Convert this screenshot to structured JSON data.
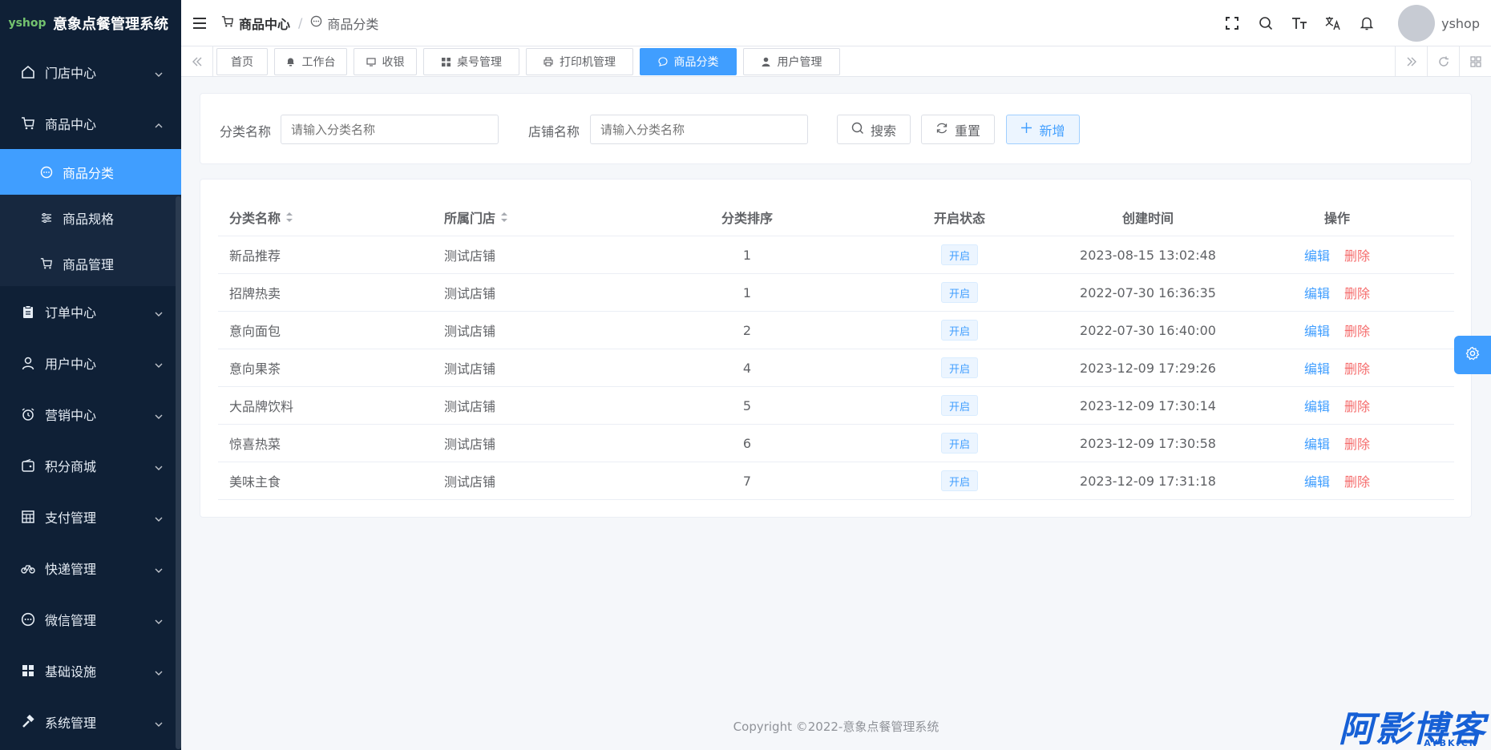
{
  "app": {
    "logo_text": "yshop",
    "title": "意象点餐管理系统"
  },
  "sidebar": {
    "items": [
      {
        "label": "门店中心",
        "icon": "home-icon"
      },
      {
        "label": "商品中心",
        "icon": "cart-icon",
        "expanded": true,
        "children": [
          {
            "label": "商品分类",
            "icon": "chat-icon",
            "active": true
          },
          {
            "label": "商品规格",
            "icon": "sliders-icon"
          },
          {
            "label": "商品管理",
            "icon": "cart-icon"
          }
        ]
      },
      {
        "label": "订单中心",
        "icon": "clipboard-icon"
      },
      {
        "label": "用户中心",
        "icon": "user-icon"
      },
      {
        "label": "营销中心",
        "icon": "alarm-icon"
      },
      {
        "label": "积分商城",
        "icon": "wallet-icon"
      },
      {
        "label": "支付管理",
        "icon": "calculator-icon"
      },
      {
        "label": "快递管理",
        "icon": "bicycle-icon"
      },
      {
        "label": "微信管理",
        "icon": "chat-icon"
      },
      {
        "label": "基础设施",
        "icon": "grid-icon"
      },
      {
        "label": "系统管理",
        "icon": "hammer-icon"
      }
    ]
  },
  "header": {
    "breadcrumb": {
      "parent": "商品中心",
      "sep": "/",
      "current": "商品分类"
    },
    "username": "yshop"
  },
  "tags": [
    {
      "label": "首页",
      "icon": ""
    },
    {
      "label": "工作台",
      "icon": "bell-icon"
    },
    {
      "label": "收银",
      "icon": "monitor-icon"
    },
    {
      "label": "桌号管理",
      "icon": "grid-icon"
    },
    {
      "label": "打印机管理",
      "icon": "printer-icon"
    },
    {
      "label": "商品分类",
      "icon": "chat-icon",
      "active": true
    },
    {
      "label": "用户管理",
      "icon": "user-icon"
    }
  ],
  "search": {
    "category_label": "分类名称",
    "category_placeholder": "请输入分类名称",
    "store_label": "店铺名称",
    "store_placeholder": "请输入分类名称",
    "search_btn": "搜索",
    "reset_btn": "重置",
    "add_btn": "新增"
  },
  "table": {
    "columns": [
      "分类名称",
      "所属门店",
      "分类排序",
      "开启状态",
      "创建时间",
      "操作"
    ],
    "edit_label": "编辑",
    "delete_label": "删除",
    "rows": [
      {
        "name": "新品推荐",
        "store": "测试店铺",
        "sort": "1",
        "status": "开启",
        "created": "2023-08-15 13:02:48"
      },
      {
        "name": "招牌热卖",
        "store": "测试店铺",
        "sort": "1",
        "status": "开启",
        "created": "2022-07-30 16:36:35"
      },
      {
        "name": "意向面包",
        "store": "测试店铺",
        "sort": "2",
        "status": "开启",
        "created": "2022-07-30 16:40:00"
      },
      {
        "name": "意向果茶",
        "store": "测试店铺",
        "sort": "4",
        "status": "开启",
        "created": "2023-12-09 17:29:26"
      },
      {
        "name": "大品牌饮料",
        "store": "测试店铺",
        "sort": "5",
        "status": "开启",
        "created": "2023-12-09 17:30:14"
      },
      {
        "name": "惊喜热菜",
        "store": "测试店铺",
        "sort": "6",
        "status": "开启",
        "created": "2023-12-09 17:30:58"
      },
      {
        "name": "美味主食",
        "store": "测试店铺",
        "sort": "7",
        "status": "开启",
        "created": "2023-12-09 17:31:18"
      }
    ]
  },
  "footer": {
    "copyright": "Copyright ©2022-意象点餐管理系统"
  },
  "watermark": {
    "text": "阿影博客",
    "sub": "AYBK.CN"
  },
  "colors": {
    "sidebar_bg": "#0f2036",
    "primary": "#409eff",
    "danger": "#f56c6c"
  }
}
